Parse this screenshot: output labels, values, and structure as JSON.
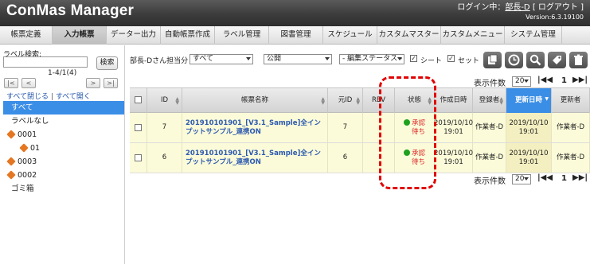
{
  "header": {
    "brand": "ConMas Manager",
    "login_prefix": "ログイン中：",
    "user": "部長-D",
    "logout": "[ ログアウト ]",
    "version": "Version:6.3.19100"
  },
  "nav": {
    "tabs": [
      {
        "label": "帳票定義"
      },
      {
        "label": "入力帳票"
      },
      {
        "label": "データー出力"
      },
      {
        "label": "自動帳票作成"
      },
      {
        "label": "ラベル管理"
      },
      {
        "label": "図書管理"
      },
      {
        "label": "スケジュール"
      },
      {
        "label": "カスタムマスター"
      },
      {
        "label": "カスタムメニュー"
      },
      {
        "label": "システム管理"
      }
    ]
  },
  "sidebar": {
    "search_label": "ラベル検索:",
    "search_button": "検索",
    "pager_text": "1-4/1(4)",
    "pager_buttons": [
      "|<",
      "<",
      ">",
      ">|"
    ],
    "collapse_all": "すべて閉じる",
    "separator": "|",
    "expand_all": "すべて開く",
    "tree": [
      {
        "label": "すべて"
      },
      {
        "label": "ラベルなし"
      },
      {
        "label": "0001"
      },
      {
        "label": "01"
      },
      {
        "label": "0003"
      },
      {
        "label": "0002"
      },
      {
        "label": "ゴミ箱"
      }
    ]
  },
  "toolbar": {
    "owner_label": "部長-Dさん担当分",
    "owner_value": "すべて",
    "visibility_value": "公開",
    "edit_status_value": "- 編集ステータス -",
    "sheet_label": "シート",
    "set_label": "セット",
    "sheet_checked": "✓",
    "set_checked": "✓"
  },
  "paging": {
    "display_count_label": "表示件数",
    "display_count_value": "20",
    "first": "|◀◀",
    "page": "1",
    "last": "▶▶|"
  },
  "table": {
    "columns": [
      {
        "label": ""
      },
      {
        "label": "ID"
      },
      {
        "label": "帳票名称"
      },
      {
        "label": "元ID"
      },
      {
        "label": "REV"
      },
      {
        "label": "状態"
      },
      {
        "label": "作成日時"
      },
      {
        "label": "登録者"
      },
      {
        "label": "更新日時"
      },
      {
        "label": "更新者"
      }
    ],
    "rows": [
      {
        "id": "7",
        "name": "201910101901_[V3.1_Sample]全インプットサンプル_連携ON",
        "source_id": "7",
        "rev": "",
        "status_line1": "承認",
        "status_line2": "待ち",
        "created": "2019/10/10 19:01",
        "registrant": "作業者-D",
        "updated": "2019/10/10 19:01",
        "updater": "作業者-D"
      },
      {
        "id": "6",
        "name": "201910101901_[V3.1_Sample]全インプットサンプル_連携ON",
        "source_id": "6",
        "rev": "",
        "status_line1": "承認",
        "status_line2": "待ち",
        "created": "2019/10/10 19:01",
        "registrant": "作業者-D",
        "updated": "2019/10/10 19:01",
        "updater": "作業者-D"
      }
    ]
  },
  "colors": {
    "highlight_column": "#3b8ee6",
    "row_background": "#fbfbd9",
    "callout_border": "#e10000"
  }
}
